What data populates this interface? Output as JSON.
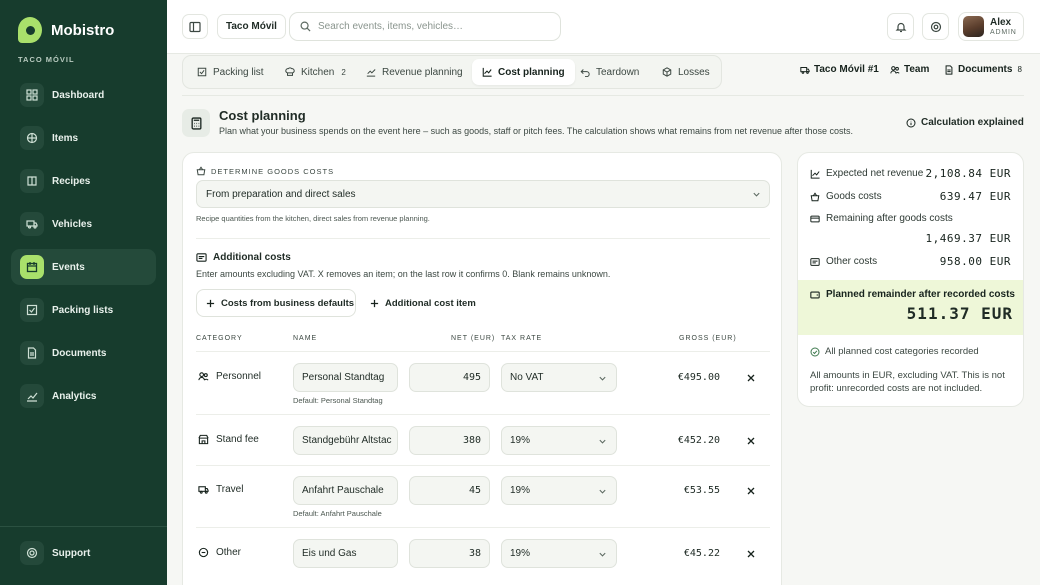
{
  "brand": {
    "name": "Mobistro",
    "subtitle": "TACO MÓVIL"
  },
  "sidebar": {
    "items": [
      {
        "label": "Dashboard",
        "icon": "grid-icon"
      },
      {
        "label": "Items",
        "icon": "box-icon"
      },
      {
        "label": "Recipes",
        "icon": "book-icon"
      },
      {
        "label": "Vehicles",
        "icon": "truck-icon"
      },
      {
        "label": "Events",
        "icon": "calendar-icon",
        "active": true
      },
      {
        "label": "Packing lists",
        "icon": "checklist-icon"
      },
      {
        "label": "Documents",
        "icon": "document-icon"
      },
      {
        "label": "Analytics",
        "icon": "chart-icon"
      }
    ],
    "support": "Support"
  },
  "topbar": {
    "event_label": "Taco Móvil",
    "search_placeholder": "Search events, items, vehicles…",
    "user": {
      "name": "Alex",
      "role": "ADMIN"
    }
  },
  "tabs": [
    {
      "label": "Packing list",
      "icon": "checklist-icon"
    },
    {
      "label": "Kitchen",
      "icon": "chef-icon",
      "badge": "2"
    },
    {
      "label": "Revenue planning",
      "icon": "trend-icon"
    },
    {
      "label": "Cost planning",
      "icon": "chart-icon",
      "active": true
    },
    {
      "label": "Teardown",
      "icon": "undo-icon"
    },
    {
      "label": "Losses",
      "icon": "box-icon"
    }
  ],
  "right_links": {
    "vehicle": "Taco Móvil #1",
    "team": "Team",
    "documents": "Documents",
    "documents_count": "8"
  },
  "page": {
    "title": "Cost planning",
    "subtitle": "Plan what your business spends on the event here – such as goods, staff or pitch fees. The calculation shows what remains from net revenue after those costs.",
    "calc_link": "Calculation explained"
  },
  "goods": {
    "section_label": "DETERMINE GOODS COSTS",
    "select_value": "From preparation and direct sales",
    "hint": "Recipe quantities from the kitchen, direct sales from revenue planning."
  },
  "additional": {
    "title": "Additional costs",
    "subtitle": "Enter amounts excluding VAT. X removes an item; on the last row it confirms 0. Blank remains unknown.",
    "btn_defaults": "Costs from business defaults",
    "btn_add": "Additional cost item",
    "headers": {
      "category": "CATEGORY",
      "name": "NAME",
      "net": "NET (EUR)",
      "tax": "TAX RATE",
      "gross": "GROSS (EUR)"
    },
    "rows": [
      {
        "category": "Personnel",
        "icon": "people-icon",
        "name": "Personal Standtag",
        "net": "495",
        "tax": "No VAT",
        "gross": "€495.00",
        "default": "Default: Personal Standtag"
      },
      {
        "category": "Stand fee",
        "icon": "store-icon",
        "name": "Standgebühr Altstac",
        "net": "380",
        "tax": "19%",
        "gross": "€452.20",
        "default": ""
      },
      {
        "category": "Travel",
        "icon": "truck-icon",
        "name": "Anfahrt Pauschale",
        "net": "45",
        "tax": "19%",
        "gross": "€53.55",
        "default": "Default: Anfahrt Pauschale"
      },
      {
        "category": "Other",
        "icon": "circle-icon",
        "name": "Eis und Gas",
        "net": "38",
        "tax": "19%",
        "gross": "€45.22",
        "default": ""
      }
    ]
  },
  "summary": {
    "expected_label": "Expected net revenue",
    "expected_value": "2,108.84 EUR",
    "goods_label": "Goods costs",
    "goods_value": "639.47 EUR",
    "remaining_label": "Remaining after goods costs",
    "remaining_value": "1,469.37 EUR",
    "other_label": "Other costs",
    "other_value": "958.00 EUR",
    "planned_label": "Planned remainder after recorded costs",
    "planned_value": "511.37 EUR",
    "status": "All planned cost categories recorded",
    "note": "All amounts in EUR, excluding VAT. This is not profit: unrecorded costs are not included."
  },
  "colors": {
    "sidebar": "#173c2d",
    "accent": "#a9e06b",
    "highlight": "#eef7d8"
  }
}
